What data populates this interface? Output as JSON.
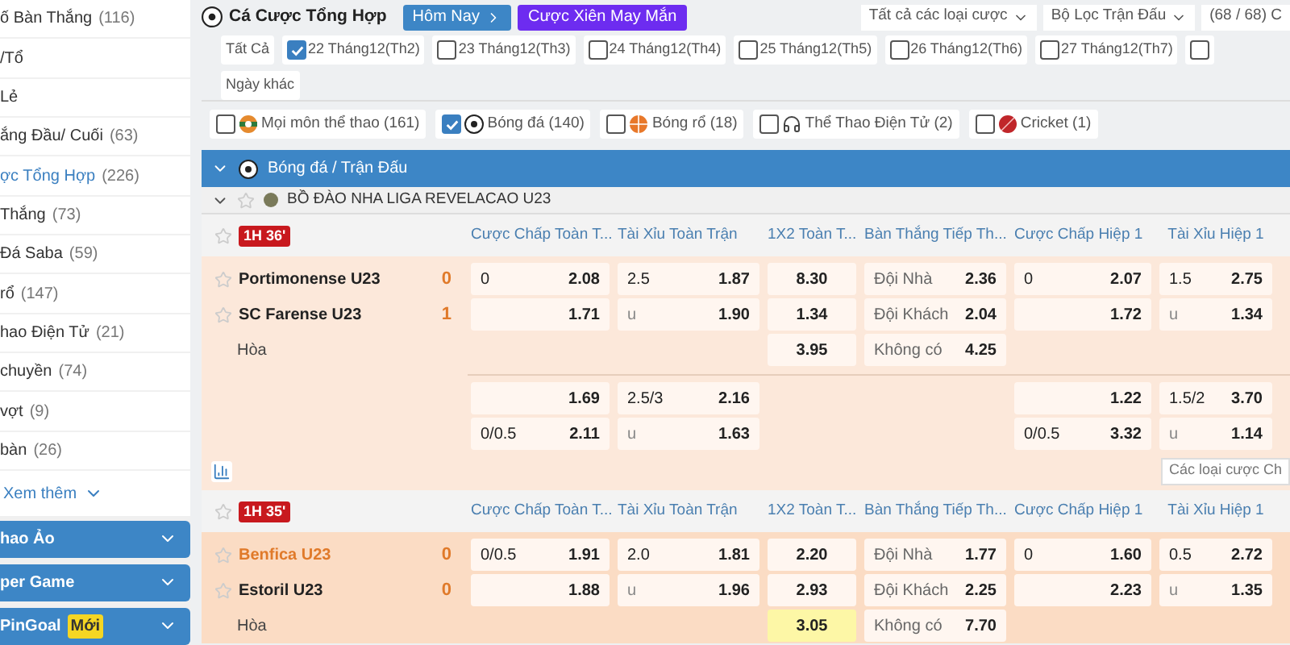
{
  "sidebar": {
    "items": [
      {
        "label": "ố Bàn Thắng",
        "count": "(116)",
        "selected": false
      },
      {
        "label": "/Tổ",
        "selected": false
      },
      {
        "label": "Lẻ",
        "selected": false
      },
      {
        "label": "ắng Đầu/ Cuối",
        "count": "(63)",
        "selected": false
      },
      {
        "label": "ợc Tổng Hợp",
        "count": "(226)",
        "selected": true
      },
      {
        "label": "Thắng",
        "count": "(73)",
        "selected": false
      },
      {
        "label": "Đá Saba",
        "count": "(59)",
        "selected": false
      },
      {
        "label": "rổ",
        "count": "(147)",
        "selected": false
      },
      {
        "label": "hao Điện Tử",
        "count": "(21)",
        "selected": false
      },
      {
        "label": "chuyền",
        "count": "(74)",
        "selected": false
      },
      {
        "label": "vợt",
        "count": "(9)",
        "selected": false
      },
      {
        "label": "bàn",
        "count": "(26)",
        "selected": false
      }
    ],
    "more": "Xem thêm",
    "sections": [
      {
        "label": "hao Ảo"
      },
      {
        "label": "per Game"
      },
      {
        "label": "PinGoal",
        "badge": "Mới"
      }
    ]
  },
  "header": {
    "title": "Cá Cược Tổng Hợp",
    "today_button": "Hôm Nay",
    "lucky_button": "Cược Xiên May Mắn",
    "bet_type_filter": "Tất cả các loại cược",
    "match_filter": "Bộ Lọc Trận Đấu",
    "count": "(68 / 68) C"
  },
  "dates": [
    {
      "kind": "plain",
      "label": "Tất Cả"
    },
    {
      "kind": "checkbox",
      "label": "22 Tháng12(Th2)",
      "checked": true
    },
    {
      "kind": "checkbox",
      "label": "23 Tháng12(Th3)",
      "checked": false
    },
    {
      "kind": "checkbox",
      "label": "24 Tháng12(Th4)",
      "checked": false
    },
    {
      "kind": "checkbox",
      "label": "25 Tháng12(Th5)",
      "checked": false
    },
    {
      "kind": "checkbox",
      "label": "26 Tháng12(Th6)",
      "checked": false
    },
    {
      "kind": "checkbox",
      "label": "27 Tháng12(Th7)",
      "checked": false
    },
    {
      "kind": "checkbox",
      "checked": false
    },
    {
      "kind": "plain",
      "label": "Ngày khác"
    }
  ],
  "sports": [
    {
      "kind": "all",
      "label": "Mọi môn thể thao (161)",
      "checked": false
    },
    {
      "kind": "soccer",
      "label": "Bóng đá (140)",
      "checked": true
    },
    {
      "kind": "basketball",
      "label": "Bóng rổ (18)",
      "checked": false
    },
    {
      "kind": "esports",
      "label": "Thể Thao Điện Tử (2)",
      "checked": false
    },
    {
      "kind": "cricket",
      "label": "Cricket (1)",
      "checked": false
    }
  ],
  "section_title": "Bóng đá / Trận Đấu",
  "league": "BỒ ĐÀO NHA LIGA REVELACAO U23",
  "matches": [
    {
      "time": "1H 36'",
      "columns": [
        "Cược Chấp Toàn T...",
        "Tài Xỉu Toàn Trận",
        "1X2 Toàn T...",
        "Bàn Thắng Tiếp Th...",
        "Cược Chấp Hiệp 1",
        "Tài Xỉu Hiệp 1"
      ],
      "teams": [
        {
          "name": "Portimonense U23",
          "score": "0",
          "highlight": false
        },
        {
          "name": "SC Farense U23",
          "score": "1",
          "highlight": false
        }
      ],
      "draw": "Hòa",
      "main_rows": [
        [
          {
            "line": "0",
            "odd": "2.08"
          },
          {
            "line": "2.5",
            "odd": "1.87"
          },
          {
            "odd": "8.30"
          },
          {
            "line": "Đội Nhà",
            "odd": "2.36"
          },
          {
            "line": "0",
            "odd": "2.07"
          },
          {
            "line": "1.5",
            "odd": "2.75"
          }
        ],
        [
          {
            "odd": "1.71"
          },
          {
            "line": "u",
            "odd": "1.90"
          },
          {
            "odd": "1.34"
          },
          {
            "line": "Đội Khách",
            "odd": "2.04"
          },
          {
            "odd": "1.72"
          },
          {
            "line": "u",
            "odd": "1.34"
          }
        ],
        [
          null,
          null,
          {
            "odd": "3.95"
          },
          {
            "line": "Không có",
            "odd": "4.25"
          },
          null,
          null
        ]
      ],
      "extra_rows": [
        [
          {
            "odd": "1.69"
          },
          {
            "line": "2.5/3",
            "odd": "2.16"
          },
          null,
          null,
          {
            "odd": "1.22"
          },
          {
            "line": "1.5/2",
            "odd": "3.70"
          }
        ],
        [
          {
            "line": "0/0.5",
            "odd": "2.11"
          },
          {
            "line": "u",
            "odd": "1.63"
          },
          null,
          null,
          {
            "line": "0/0.5",
            "odd": "3.32"
          },
          {
            "line": "u",
            "odd": "1.14"
          }
        ]
      ],
      "more_bets": "Các loại cược Ch"
    },
    {
      "time": "1H 35'",
      "columns": [
        "Cược Chấp Toàn T...",
        "Tài Xỉu Toàn Trận",
        "1X2 Toàn T...",
        "Bàn Thắng Tiếp Th...",
        "Cược Chấp Hiệp 1",
        "Tài Xỉu Hiệp 1"
      ],
      "teams": [
        {
          "name": "Benfica U23",
          "score": "0",
          "highlight": true
        },
        {
          "name": "Estoril U23",
          "score": "0",
          "highlight": false
        }
      ],
      "draw": "Hòa",
      "main_rows": [
        [
          {
            "line": "0/0.5",
            "odd": "1.91"
          },
          {
            "line": "2.0",
            "odd": "1.81"
          },
          {
            "odd": "2.20"
          },
          {
            "line": "Đội Nhà",
            "odd": "1.77"
          },
          {
            "line": "0",
            "odd": "1.60"
          },
          {
            "line": "0.5",
            "odd": "2.72"
          }
        ],
        [
          {
            "odd": "1.88"
          },
          {
            "line": "u",
            "odd": "1.96"
          },
          {
            "odd": "2.93"
          },
          {
            "line": "Đội Khách",
            "odd": "2.25"
          },
          {
            "odd": "2.23"
          },
          {
            "line": "u",
            "odd": "1.35"
          }
        ],
        [
          null,
          null,
          {
            "odd": "3.05",
            "highlight": true
          },
          {
            "line": "Không có",
            "odd": "7.70"
          },
          null,
          null
        ]
      ]
    }
  ]
}
